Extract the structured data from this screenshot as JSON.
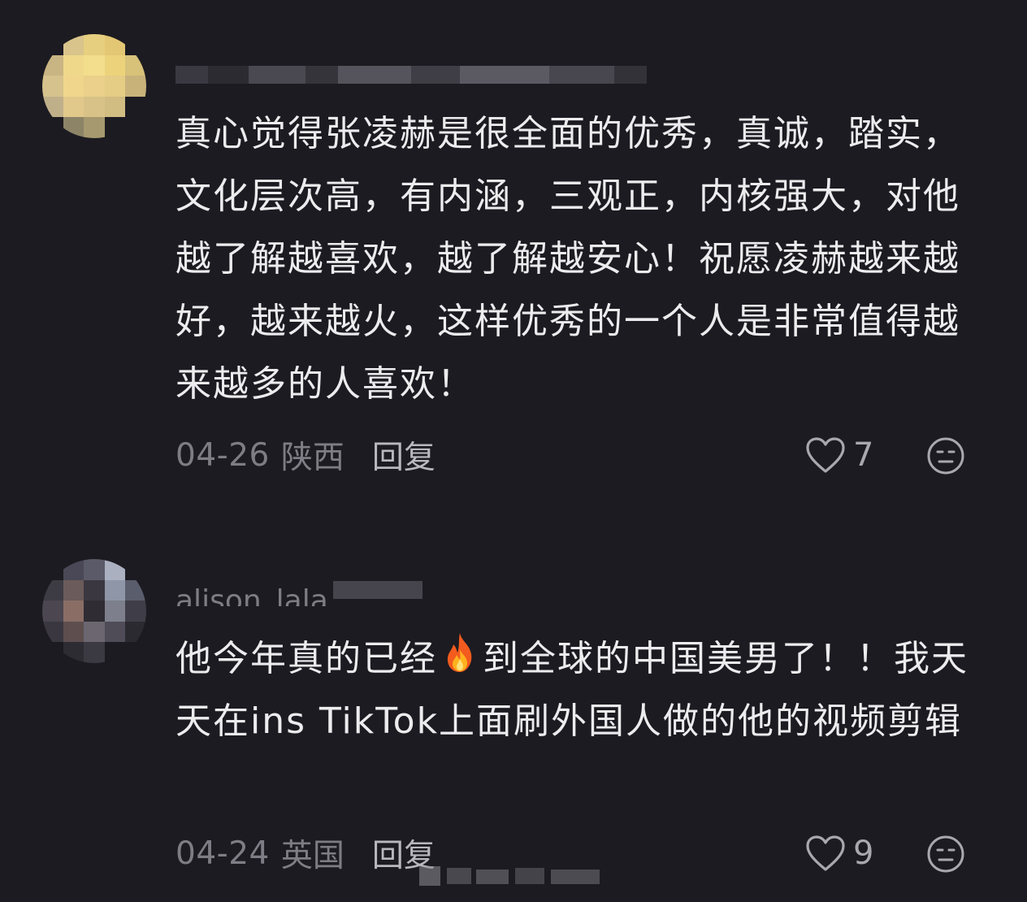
{
  "comments": [
    {
      "username": "",
      "text": "真心觉得张凌赫是很全面的优秀，真诚，踏实，文化层次高，有内涵，三观正，内核强大，对他越了解越喜欢，越了解越安心！祝愿凌赫越来越好，越来越火，这样优秀的一个人是非常值得越来越多的人喜欢！",
      "date": "04-26",
      "location": "陕西",
      "reply_label": "回复",
      "likes": "7",
      "avatar_colors": [
        "#1c1b21",
        "#d9c48c",
        "#e6cf7f",
        "#e4c774",
        "#1c1b21",
        "#c9b583",
        "#efd88a",
        "#f2de8c",
        "#ecd37b",
        "#d8c27a",
        "#d6c28c",
        "#f0d68c",
        "#ead08a",
        "#e6cd85",
        "#c9b27a",
        "#bfb08a",
        "#e1c98b",
        "#d9c288",
        "#d1bc82",
        "#1c1b21",
        "#1c1b21",
        "#8d8468",
        "#a6996f",
        "#1c1b21",
        "#1c1b21"
      ]
    },
    {
      "username": "alison_lala",
      "text_before": "他今年真的已经",
      "icon": "fire-emoji",
      "text_after": "到全球的中国美男了！！我天天在ins TikTok上面刷外国人做的他的视频剪辑",
      "date": "04-24",
      "location": "英国",
      "reply_label": "回复",
      "likes": "9",
      "avatar_colors": [
        "#1c1b21",
        "#4a4856",
        "#5b5a68",
        "#aab0c0",
        "#1c1b21",
        "#3d3b44",
        "#6b5b5a",
        "#3a3740",
        "#8f96a8",
        "#5a5d6c",
        "#4b4650",
        "#8a6e66",
        "#2f2c33",
        "#7d7f8c",
        "#3f3e48",
        "#3a3740",
        "#5e4e4e",
        "#6b6670",
        "#4f4c58",
        "#2c2a31",
        "#1c1b21",
        "#2e2c33",
        "#3b3941",
        "#1c1b21",
        "#1c1b21"
      ]
    }
  ],
  "colors": {
    "background": "#1c1b21",
    "text": "#ececee",
    "muted": "#7e7d85",
    "reply": "#b9b8bf"
  }
}
